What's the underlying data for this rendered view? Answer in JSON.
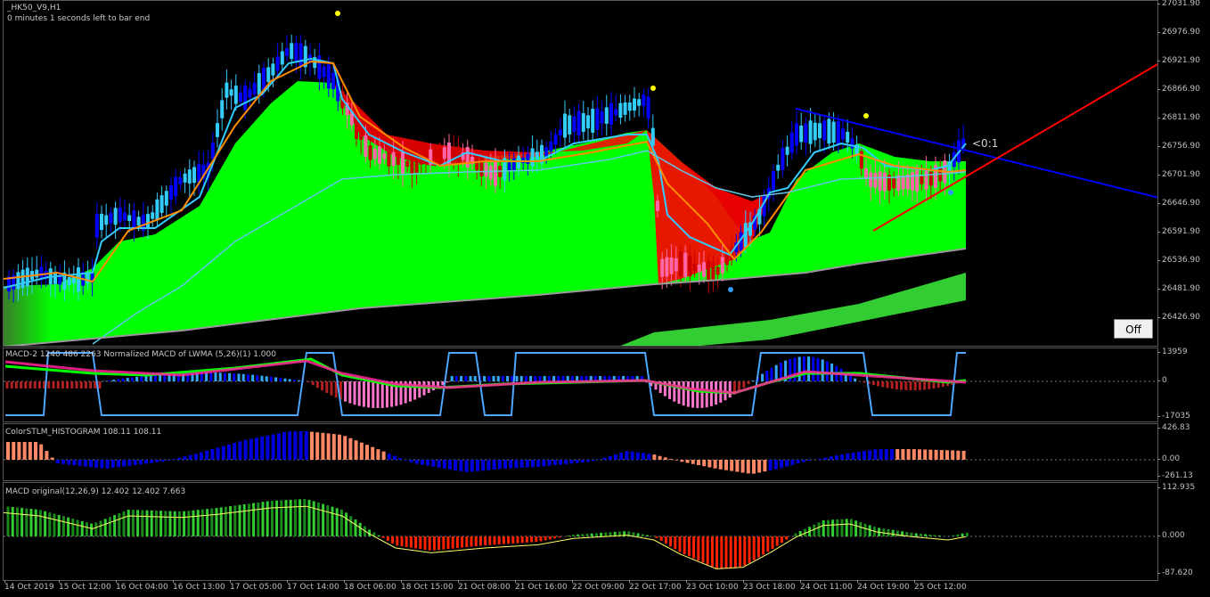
{
  "chart": {
    "symbol_label": "_HK50_V9,H1",
    "countdown": "0 minutes 1 seconds left to bar end",
    "order_label": "<0:1",
    "off_button": "Off"
  },
  "main_axis": {
    "labels": [
      "27031.90",
      "26976.90",
      "26921.90",
      "26866.90",
      "26811.90",
      "26756.90",
      "26701.90",
      "26646.90",
      "26591.90",
      "26536.90",
      "26481.90",
      "26426.90"
    ]
  },
  "subwindows": [
    {
      "label": "MACD-2 1240 486 2263 Normalized MACD of LWMA (5,26)(1) 1.000",
      "axis": [
        "13959",
        "0",
        "-17035"
      ]
    },
    {
      "label": "ColorSTLM_HISTOGRAM 108.11 108.11",
      "axis": [
        "426.83",
        "0.00",
        "-261.13"
      ]
    },
    {
      "label": "MACD original(12,26,9) 12.402 12.402 7.663",
      "axis": [
        "112.935",
        "0.000",
        "-87.620"
      ]
    }
  ],
  "time_axis": [
    "14 Oct 2019",
    "15 Oct 12:00",
    "16 Oct 04:00",
    "16 Oct 13:00",
    "17 Oct 05:00",
    "17 Oct 14:00",
    "18 Oct 06:00",
    "18 Oct 15:00",
    "21 Oct 08:00",
    "21 Oct 16:00",
    "22 Oct 09:00",
    "22 Oct 17:00",
    "23 Oct 10:00",
    "23 Oct 18:00",
    "24 Oct 11:00",
    "24 Oct 19:00",
    "25 Oct 12:00"
  ],
  "colors": {
    "bull_candle": "#0000ff",
    "bear_candle": "#ff0000",
    "cloud_up": "#00ff00",
    "cloud_down": "#ff0000",
    "fast_ma": "#33ccff",
    "slow_ma": "#ff8c00",
    "trendline_down": "#0000ff",
    "trendline_up": "#ff0000"
  }
}
